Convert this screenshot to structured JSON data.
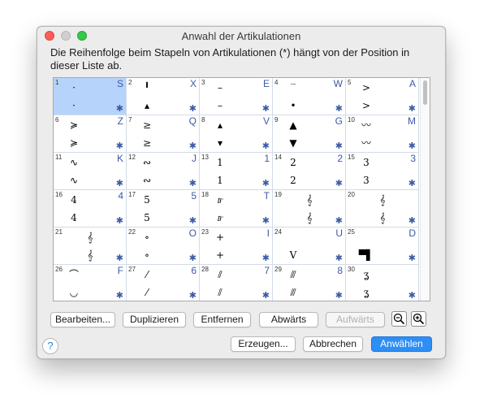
{
  "window": {
    "title": "Anwahl der Artikulationen"
  },
  "description": "Die Reihenfolge beim Stapeln von Artikulationen (*) hängt von der Position in dieser Liste ab.",
  "cells": [
    {
      "num": "1",
      "key": "S",
      "g1": "·",
      "g2": "·",
      "selected": true
    },
    {
      "num": "2",
      "key": "X",
      "g1": "╹",
      "g2": "▴"
    },
    {
      "num": "3",
      "key": "E",
      "g1": "–",
      "g2": "–"
    },
    {
      "num": "4",
      "key": "W",
      "g1": "‾",
      "g2": "•"
    },
    {
      "num": "5",
      "key": "A",
      "g1": ">",
      "g2": ">"
    },
    {
      "num": "6",
      "key": "Z",
      "g1": "≽",
      "g2": "≽"
    },
    {
      "num": "7",
      "key": "Q",
      "g1": "≥",
      "g2": "≥"
    },
    {
      "num": "8",
      "key": "V",
      "g1": "▴",
      "g2": "▾"
    },
    {
      "num": "9",
      "key": "G",
      "g1": "▲",
      "g2": "▼"
    },
    {
      "num": "10",
      "key": "M",
      "g1": "〰",
      "g2": "〰"
    },
    {
      "num": "11",
      "key": "K",
      "g1": "∿",
      "g2": "∿"
    },
    {
      "num": "12",
      "key": "J",
      "g1": "∾",
      "g2": "∾"
    },
    {
      "num": "13",
      "key": "1",
      "g1": "1",
      "g2": "1"
    },
    {
      "num": "14",
      "key": "2",
      "g1": "2",
      "g2": "2"
    },
    {
      "num": "15",
      "key": "3",
      "g1": "3",
      "g2": "3"
    },
    {
      "num": "16",
      "key": "4",
      "g1": "4",
      "g2": "4"
    },
    {
      "num": "17",
      "key": "5",
      "g1": "5",
      "g2": "5"
    },
    {
      "num": "18",
      "key": "T",
      "g1": "𝆖",
      "g2": "𝆖"
    },
    {
      "num": "19",
      "key": "",
      "g1": "𝄞",
      "g2": "𝄞",
      "right": true
    },
    {
      "num": "20",
      "key": "",
      "g1": "𝄞",
      "g2": "𝄞",
      "right": true
    },
    {
      "num": "21",
      "key": "",
      "g1": "𝄞",
      "g2": "𝄞",
      "right": true
    },
    {
      "num": "22",
      "key": "O",
      "g1": "∘",
      "g2": "∘"
    },
    {
      "num": "23",
      "key": "I",
      "g1": "+",
      "g2": "+"
    },
    {
      "num": "24",
      "key": "U",
      "g1": "",
      "g2": "V"
    },
    {
      "num": "25",
      "key": "D",
      "g1": "",
      "g2": "▀▌"
    },
    {
      "num": "26",
      "key": "F",
      "g1": "⌒",
      "g2": "◡"
    },
    {
      "num": "27",
      "key": "6",
      "g1": "⁄",
      "g2": "⁄"
    },
    {
      "num": "28",
      "key": "7",
      "g1": "⫽",
      "g2": "⫽"
    },
    {
      "num": "29",
      "key": "8",
      "g1": "⫻",
      "g2": "⫻"
    },
    {
      "num": "30",
      "key": "",
      "g1": "ʓ",
      "g2": "ʓ"
    }
  ],
  "buttons": {
    "edit": "Bearbeiten...",
    "duplicate": "Duplizieren",
    "remove": "Entfernen",
    "down": "Abwärts",
    "up": "Aufwärts",
    "create": "Erzeugen...",
    "cancel": "Abbrechen",
    "select": "Anwählen"
  },
  "help": "?",
  "colors": {
    "selection": "#b6d4fb",
    "accent": "#3c5aa6",
    "primary": "#2d8ef5"
  },
  "icons": {
    "zoom_out": "zoom-out-icon",
    "zoom_in": "zoom-in-icon"
  }
}
